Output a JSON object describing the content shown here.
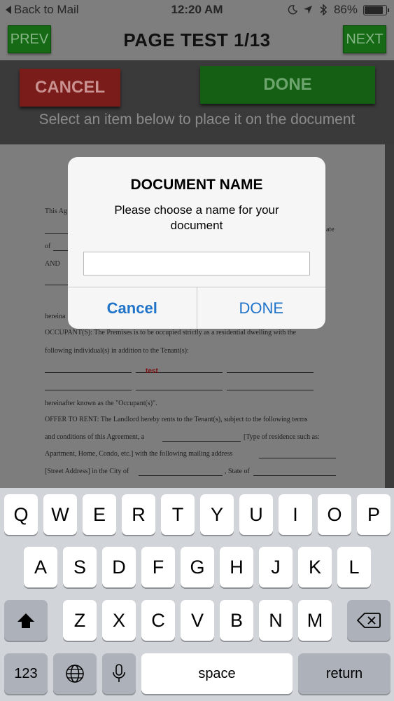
{
  "status_bar": {
    "back_label": "Back to Mail",
    "time": "12:20 AM",
    "battery": "86%",
    "battery_level": 0.86
  },
  "nav": {
    "prev_label": "PREV",
    "title": "PAGE TEST 1/13",
    "next_label": "NEXT"
  },
  "toolbar": {
    "cancel_label": "CANCEL",
    "done_label": "DONE",
    "hint": "Select an item below to place it on the document"
  },
  "document": {
    "lines": [
      "This Ag",
      "of",
      "AND",
      "hereina",
      "OCCUPANT(S): The Premises is to be occupied strictly as a residential dwelling with the",
      "following individual(s) in addition to the Tenant(s):",
      "hereinafter known as the \"Occupant(s)\".",
      "OFFER TO RENT: The Landlord hereby rents to the Tenant(s), subject to the following terms",
      "and conditions of this Agreement, a",
      "[Type of residence such as:",
      "Apartment, Home, Condo, etc.] with the following mailing address",
      "[Street Address] in the City of",
      ", State of",
      "ate"
    ],
    "placed_text": "test"
  },
  "alert": {
    "title": "DOCUMENT NAME",
    "message": "Please choose a name for your document",
    "input_value": "",
    "cancel_label": "Cancel",
    "done_label": "DONE"
  },
  "keyboard": {
    "row1": [
      "Q",
      "W",
      "E",
      "R",
      "T",
      "Y",
      "U",
      "I",
      "O",
      "P"
    ],
    "row2": [
      "A",
      "S",
      "D",
      "F",
      "G",
      "H",
      "J",
      "K",
      "L"
    ],
    "row3": [
      "Z",
      "X",
      "C",
      "V",
      "B",
      "N",
      "M"
    ],
    "numbers_label": "123",
    "space_label": "space",
    "return_label": "return"
  }
}
